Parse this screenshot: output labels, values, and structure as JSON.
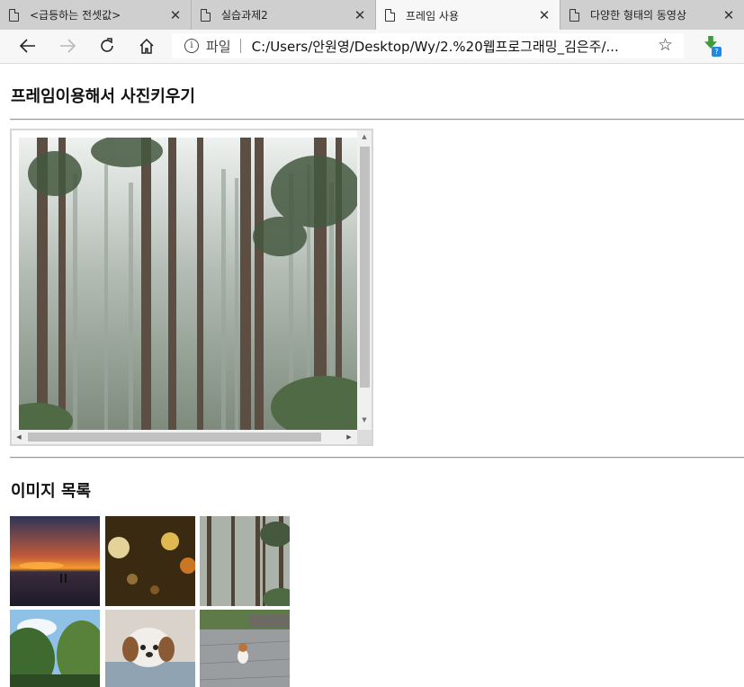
{
  "tabs": [
    {
      "title": "<급등하는 전셋값>",
      "active": false
    },
    {
      "title": "실습과제2",
      "active": false
    },
    {
      "title": "프레임 사용",
      "active": true
    },
    {
      "title": "다양한 형태의 동영상",
      "active": false
    }
  ],
  "toolbar": {
    "scheme_label": "파일",
    "url": "C:/Users/안원영/Desktop/Wy/2.%20웹프로그래밍_김은주/...",
    "extension_badge": "?"
  },
  "page": {
    "heading1": "프레임이용해서 사진키우기",
    "heading2": "이미지 목록"
  },
  "frame_image": "forest",
  "thumbnails": [
    "sunset",
    "rain-bokeh",
    "forest",
    "palm-trees",
    "puppy-blanket",
    "puppy-path"
  ],
  "icons": {
    "back": "back-icon",
    "forward": "forward-icon",
    "refresh": "refresh-icon",
    "home": "home-icon",
    "info": "info-icon",
    "favorite": "star-icon",
    "extension": "download-extension-icon",
    "tab": "page-icon",
    "close": "close-icon"
  }
}
